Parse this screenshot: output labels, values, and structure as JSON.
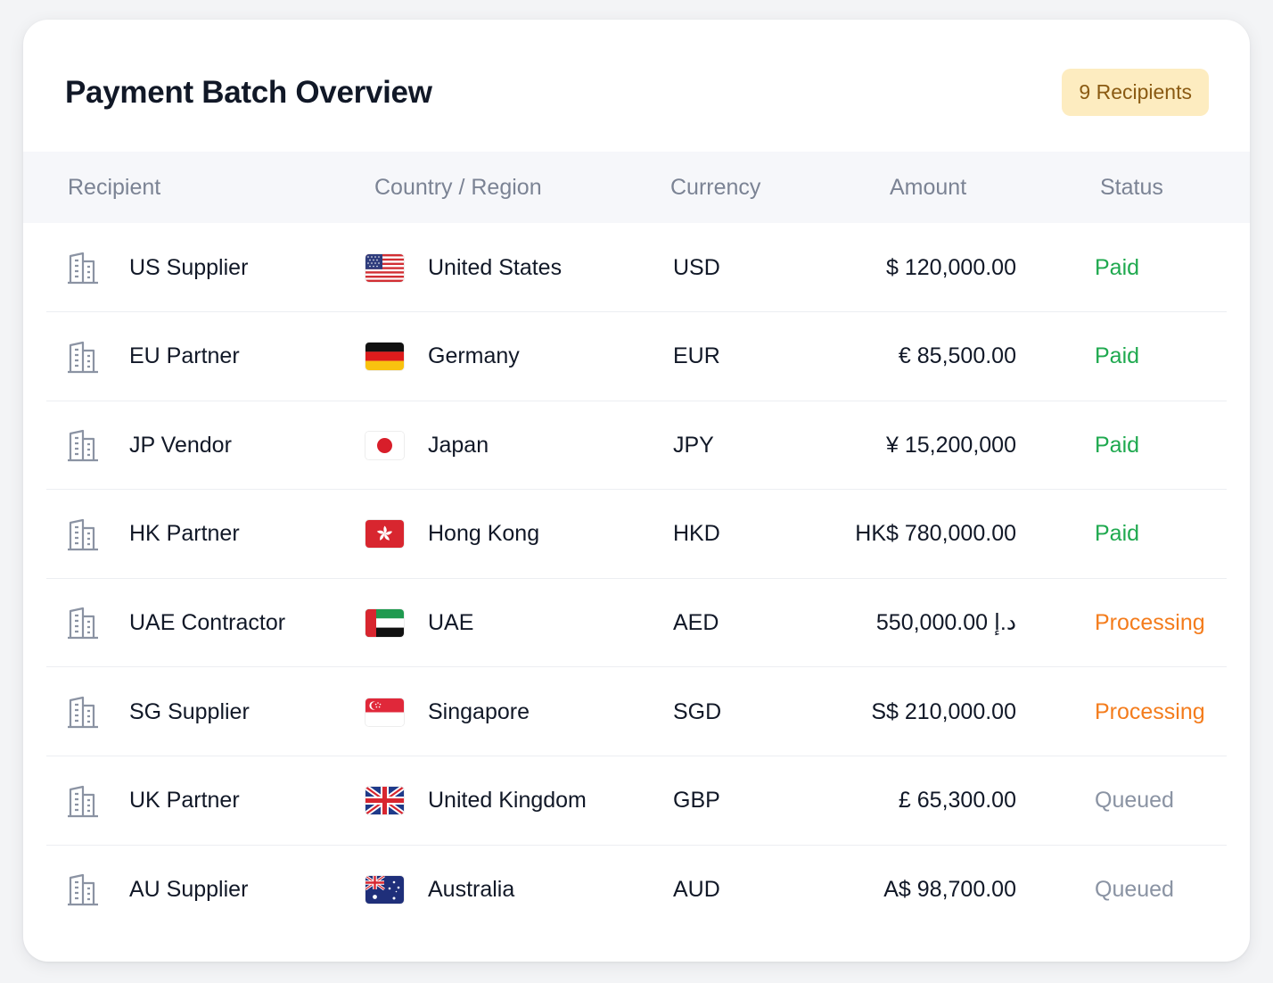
{
  "header": {
    "title": "Payment Batch Overview",
    "badge": "9 Recipients"
  },
  "table": {
    "columns": [
      "Recipient",
      "Country / Region",
      "Currency",
      "Amount",
      "Status"
    ],
    "rows": [
      {
        "recipient": "US Supplier",
        "country": "United States",
        "flag": "flag-us-icon",
        "currency": "USD",
        "amount": "$ 120,000.00",
        "status": "Paid",
        "status_color": "#1fa94f"
      },
      {
        "recipient": "EU Partner",
        "country": "Germany",
        "flag": "flag-de-icon",
        "currency": "EUR",
        "amount": "€ 85,500.00",
        "status": "Paid",
        "status_color": "#1fa94f"
      },
      {
        "recipient": "JP Vendor",
        "country": "Japan",
        "flag": "flag-jp-icon",
        "currency": "JPY",
        "amount": "¥ 15,200,000",
        "status": "Paid",
        "status_color": "#1fa94f"
      },
      {
        "recipient": "HK Partner",
        "country": "Hong Kong",
        "flag": "flag-hk-icon",
        "currency": "HKD",
        "amount": "HK$ 780,000.00",
        "status": "Paid",
        "status_color": "#1fa94f"
      },
      {
        "recipient": "UAE Contractor",
        "country": "UAE",
        "flag": "flag-ae-icon",
        "currency": "AED",
        "amount": "د.إ 550,000.00",
        "status": "Processing",
        "status_color": "#f47c1c"
      },
      {
        "recipient": "SG Supplier",
        "country": "Singapore",
        "flag": "flag-sg-icon",
        "currency": "SGD",
        "amount": "S$ 210,000.00",
        "status": "Processing",
        "status_color": "#f47c1c"
      },
      {
        "recipient": "UK Partner",
        "country": "United Kingdom",
        "flag": "flag-gb-icon",
        "currency": "GBP",
        "amount": "£ 65,300.00",
        "status": "Queued",
        "status_color": "#8a93a3"
      },
      {
        "recipient": "AU Supplier",
        "country": "Australia",
        "flag": "flag-au-icon",
        "currency": "AUD",
        "amount": "A$ 98,700.00",
        "status": "Queued",
        "status_color": "#8a93a3"
      }
    ]
  },
  "icons": {
    "recipient": "building-icon"
  },
  "colors": {
    "badge_bg": "#fdecc0",
    "badge_text": "#8a5a12",
    "header_bg": "#f6f7fa",
    "paid": "#1fa94f",
    "processing": "#f47c1c",
    "queued": "#8a93a3"
  }
}
